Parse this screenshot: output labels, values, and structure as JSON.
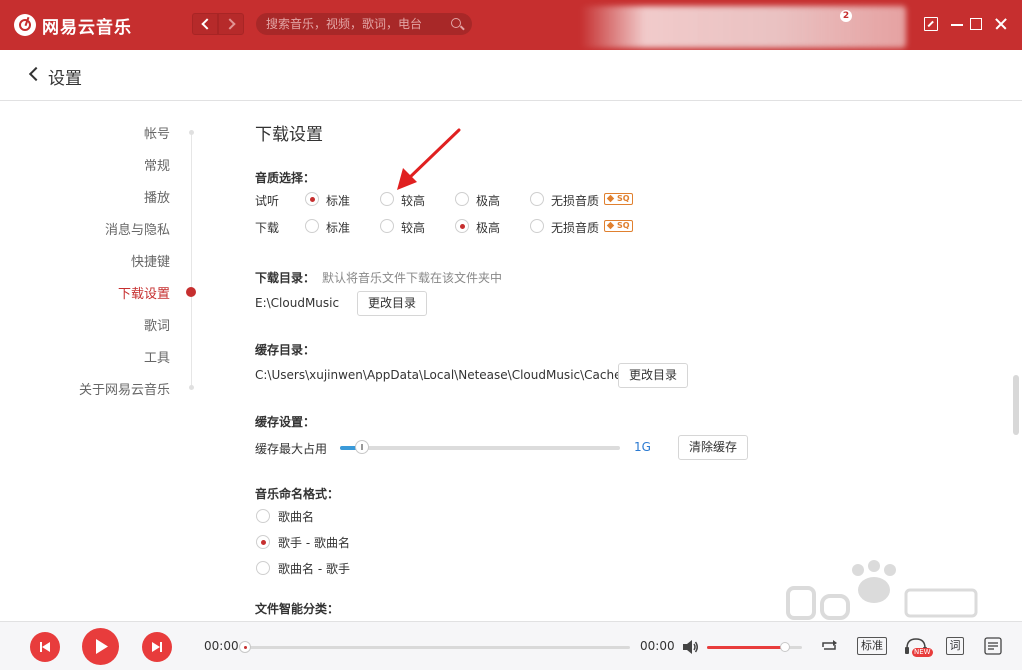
{
  "app": {
    "title": "网易云音乐",
    "search_placeholder": "搜索音乐，视频，歌词，电台",
    "message_badge": "2"
  },
  "header": {
    "title": "设置"
  },
  "sidebar": {
    "items": [
      {
        "label": "帐号",
        "active": false
      },
      {
        "label": "常规",
        "active": false
      },
      {
        "label": "播放",
        "active": false
      },
      {
        "label": "消息与隐私",
        "active": false
      },
      {
        "label": "快捷键",
        "active": false
      },
      {
        "label": "下载设置",
        "active": true
      },
      {
        "label": "歌词",
        "active": false
      },
      {
        "label": "工具",
        "active": false
      },
      {
        "label": "关于网易云音乐",
        "active": false
      }
    ]
  },
  "download": {
    "section_title": "下载设置",
    "quality": {
      "label": "音质选择：",
      "rows": [
        {
          "label": "试听",
          "selected": 0
        },
        {
          "label": "下载",
          "selected": 2
        }
      ],
      "options": [
        "标准",
        "较高",
        "极高",
        "无损音质"
      ],
      "sq_badge": "SQ"
    },
    "dir": {
      "label": "下载目录：",
      "hint": "默认将音乐文件下载在该文件夹中",
      "path": "E:\\CloudMusic",
      "button": "更改目录"
    },
    "cache_dir": {
      "label": "缓存目录：",
      "path": "C:\\Users\\xujinwen\\AppData\\Local\\Netease\\CloudMusic\\Cache",
      "button": "更改目录"
    },
    "cache": {
      "label": "缓存设置：",
      "max_label": "缓存最大占用",
      "value": "1G",
      "slider_fraction": 0.08,
      "button": "清除缓存"
    },
    "naming": {
      "label": "音乐命名格式：",
      "options": [
        "歌曲名",
        "歌手 - 歌曲名",
        "歌曲名 - 歌手"
      ],
      "selected": 1
    },
    "classify": {
      "label": "文件智能分类："
    }
  },
  "player": {
    "current_time": "00:00",
    "total_time": "00:00",
    "progress_fraction": 0.0,
    "volume_fraction": 0.82,
    "quality": "标准",
    "effect_badge": "NEW",
    "lyric": "词"
  },
  "colors": {
    "brand": "#c62f2f",
    "accent_blue": "#2b7ad1",
    "badge_orange": "#e0802f"
  }
}
